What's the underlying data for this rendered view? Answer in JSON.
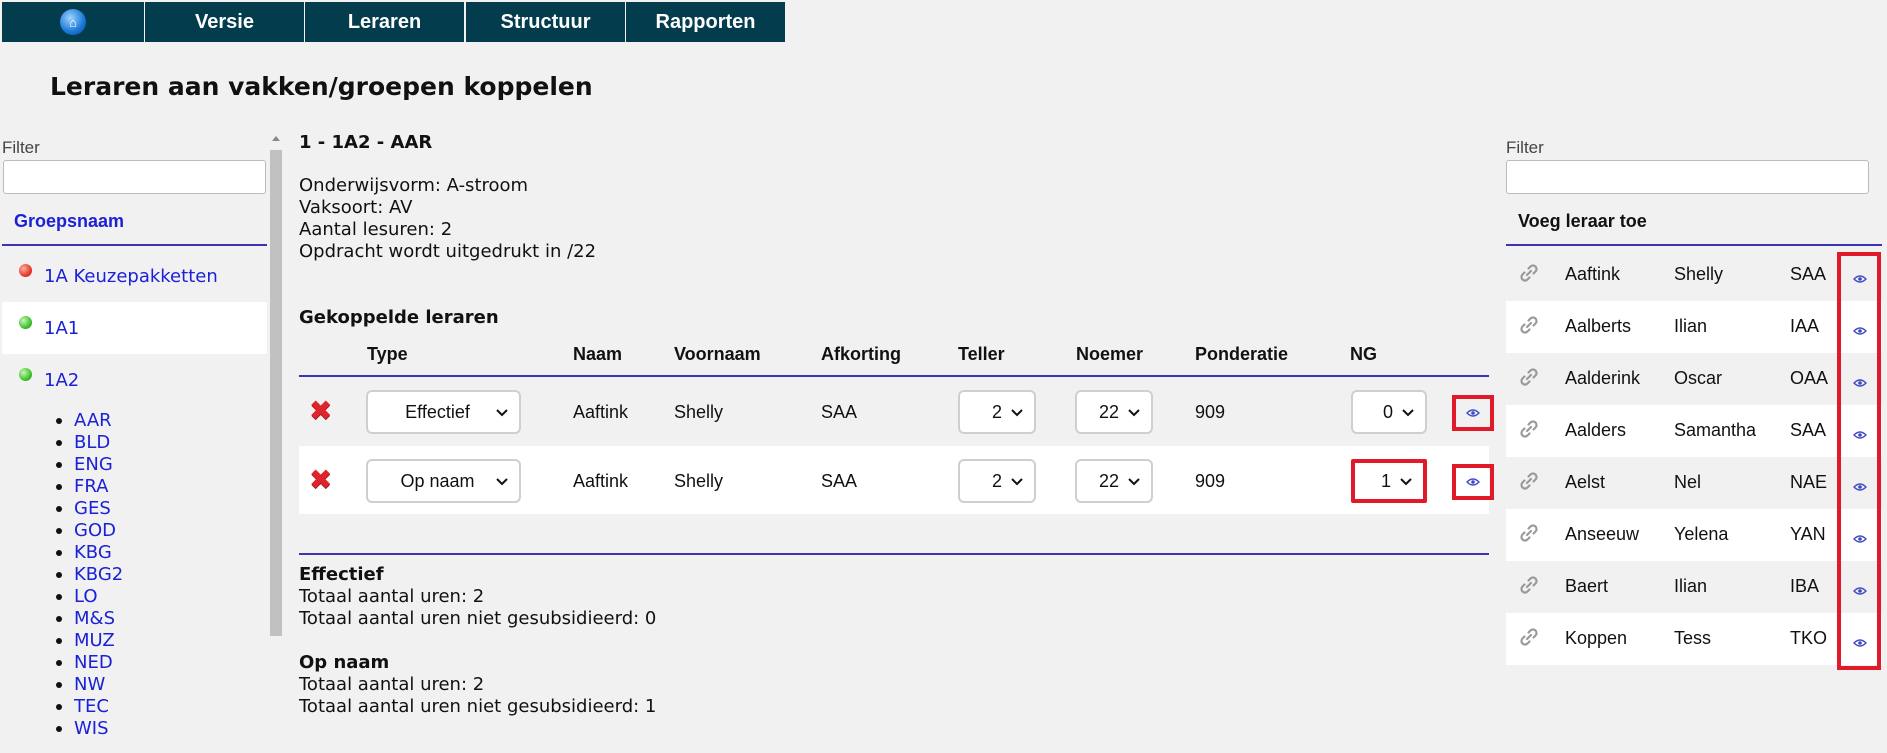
{
  "nav": {
    "home_icon": "home-icon",
    "items": [
      "Versie",
      "Leraren",
      "Structuur",
      "Rapporten"
    ]
  },
  "page_title": "Leraren aan vakken/groepen koppelen",
  "left": {
    "filter_label": "Filter",
    "filter_value": "",
    "header": "Groepsnaam",
    "groups": [
      {
        "label": "1A Keuzepakketten",
        "status": "red"
      },
      {
        "label": "1A1",
        "status": "green"
      },
      {
        "label": "1A2",
        "status": "green"
      }
    ],
    "subjects": [
      "AAR",
      "BLD",
      "ENG",
      "FRA",
      "GES",
      "GOD",
      "KBG",
      "KBG2",
      "LO",
      "M&S",
      "MUZ",
      "NED",
      "NW",
      "TEC",
      "WIS"
    ]
  },
  "main": {
    "title": "1 - 1A2 - AAR",
    "info": [
      "Onderwijsvorm: A-stroom",
      "Vaksoort: AV",
      "Aantal lesuren: 2",
      "Opdracht wordt uitgedrukt in /22"
    ],
    "linked_title": "Gekoppelde leraren",
    "columns": [
      "Type",
      "Naam",
      "Voornaam",
      "Afkorting",
      "Teller",
      "Noemer",
      "Ponderatie",
      "NG"
    ],
    "rows": [
      {
        "type": "Effectief",
        "naam": "Aaftink",
        "voornaam": "Shelly",
        "afkorting": "SAA",
        "teller": "2",
        "noemer": "22",
        "ponderatie": "909",
        "ng": "0"
      },
      {
        "type": "Op naam",
        "naam": "Aaftink",
        "voornaam": "Shelly",
        "afkorting": "SAA",
        "teller": "2",
        "noemer": "22",
        "ponderatie": "909",
        "ng": "1"
      }
    ],
    "summaries": [
      {
        "title": "Effectief",
        "total": "Totaal aantal uren: 2",
        "not_subsidized": "Totaal aantal uren niet gesubsidieerd: 0"
      },
      {
        "title": "Op naam",
        "total": "Totaal aantal uren: 2",
        "not_subsidized": "Totaal aantal uren niet gesubsidieerd: 1"
      }
    ]
  },
  "right": {
    "filter_label": "Filter",
    "filter_value": "",
    "header": "Voeg leraar toe",
    "teachers": [
      {
        "naam": "Aaftink",
        "voornaam": "Shelly",
        "afkorting": "SAA"
      },
      {
        "naam": "Aalberts",
        "voornaam": "Ilian",
        "afkorting": "IAA"
      },
      {
        "naam": "Aalderink",
        "voornaam": "Oscar",
        "afkorting": "OAA"
      },
      {
        "naam": "Aalders",
        "voornaam": "Samantha",
        "afkorting": "SAA"
      },
      {
        "naam": "Aelst",
        "voornaam": "Nel",
        "afkorting": "NAE"
      },
      {
        "naam": "Anseeuw",
        "voornaam": "Yelena",
        "afkorting": "YAN"
      },
      {
        "naam": "Baert",
        "voornaam": "Ilian",
        "afkorting": "IBA"
      },
      {
        "naam": "Koppen",
        "voornaam": "Tess",
        "afkorting": "TKO"
      }
    ]
  },
  "colors": {
    "nav_bg": "#033c4c",
    "accent_line": "#3c33b7",
    "link": "#1b21d6",
    "highlight": "#e11a2a"
  }
}
